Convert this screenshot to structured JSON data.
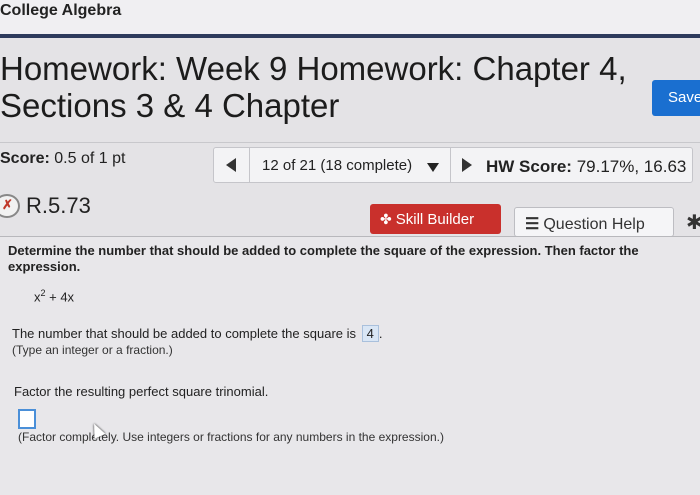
{
  "header": {
    "course_title": "College Algebra",
    "homework_title": "Homework: Week 9 Homework: Chapter 4, Sections 3 & 4 Chapter",
    "save_label": "Save"
  },
  "score_bar": {
    "score_label": "Score:",
    "score_value": "0.5 of 1 pt",
    "question_nav": "12 of 21 (18 complete)",
    "hw_score_label": "HW Score:",
    "hw_score_value": "79.17%, 16.63"
  },
  "question": {
    "id": "R.5.73",
    "skill_builder_label": "Skill Builder",
    "question_help_label": "Question Help",
    "instruction_bold": "Determine the number that should be added to complete the square of the expression. Then factor the expression.",
    "expression_base": "x",
    "expression_exp": "2",
    "expression_rest": " + 4x",
    "answer_prompt": "The number that should be added to complete the square is",
    "answer_value": "4",
    "answer_suffix": ".",
    "answer_hint": "(Type an integer or a fraction.)",
    "factor_prompt": "Factor the resulting perfect square trinomial.",
    "factor_hint": "(Factor completely. Use integers or fractions for any numbers in the expression.)"
  },
  "icons": {
    "status": "partial-credit-icon",
    "skill_builder": "skill-builder-icon",
    "question_help": "list-icon",
    "settings": "gear-icon"
  },
  "colors": {
    "header_rule": "#2d3a5c",
    "save_button": "#1a6fd0",
    "skill_builder_button": "#c9302c",
    "answer_highlight": "#d9e6f5"
  }
}
